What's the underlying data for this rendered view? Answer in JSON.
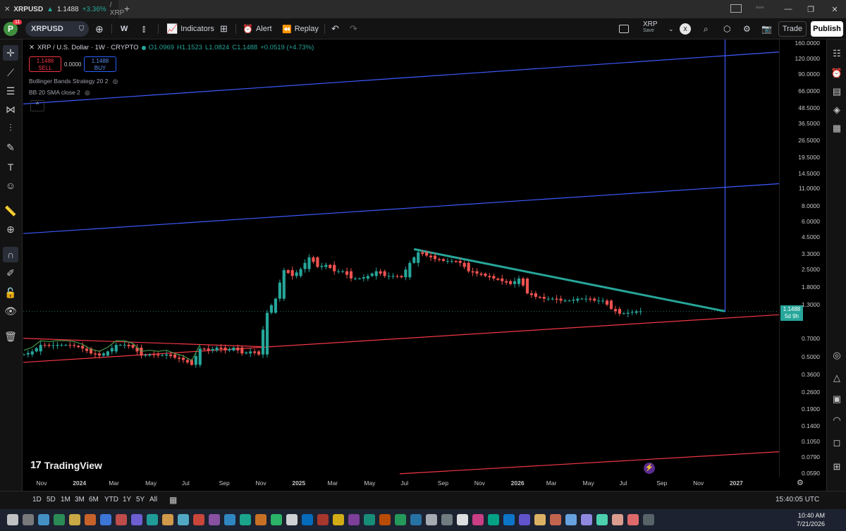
{
  "browser": {
    "tab_symbol": "XRPUSD",
    "tab_price": "1.1488",
    "tab_change": "+3.36%",
    "tab_suffix": "/ XRP",
    "new_tab": "+",
    "window_controls": [
      "minimize",
      "maximize",
      "close"
    ]
  },
  "toolbar": {
    "avatar_letter": "P",
    "avatar_badge": "11",
    "symbol": "XRPUSD",
    "interval": "W",
    "indicators": "Indicators",
    "alert": "Alert",
    "replay": "Replay",
    "layout_name": "XRP",
    "layout_sub": "Save",
    "x_badge": "X",
    "trade": "Trade",
    "publish": "Publish"
  },
  "legend": {
    "title": "XRP / U.S. Dollar · 1W · CRYPTO",
    "open": "O1.0969",
    "high": "H1.1523",
    "low": "L1.0824",
    "close": "C1.1488",
    "change": "+0.0519 (+4.73%)",
    "sell_price": "1.1488",
    "sell_label": "SELL",
    "spread": "0.0000",
    "buy_price": "1.1488",
    "buy_label": "BUY",
    "indicator1": "Bollinger Bands Strategy 20 2",
    "indicator2": "BB 20 SMA close 2",
    "collapse": "^"
  },
  "price_axis": {
    "labels": [
      "160.0000",
      "120.0000",
      "90.0000",
      "66.0000",
      "48.5000",
      "36.5000",
      "26.5000",
      "19.5000",
      "14.5000",
      "11.0000",
      "8.0000",
      "6.0000",
      "4.5000",
      "3.3000",
      "2.5000",
      "1.8000",
      "1.3000",
      "0.7000",
      "0.5000",
      "0.3600",
      "0.2600",
      "0.1900",
      "0.1400",
      "0.1050",
      "0.0790",
      "0.0590"
    ],
    "current_price": "1.1488",
    "countdown": "5d 9h"
  },
  "time_axis": {
    "labels": [
      "Nov",
      "2024",
      "Mar",
      "May",
      "Jul",
      "Sep",
      "Nov",
      "2025",
      "Mar",
      "May",
      "Jul",
      "Sep",
      "Nov",
      "2026",
      "Mar",
      "May",
      "Jul",
      "Sep",
      "Nov",
      "2027"
    ]
  },
  "bottom": {
    "ranges": [
      "1D",
      "5D",
      "1M",
      "3M",
      "6M",
      "YTD",
      "1Y",
      "5Y",
      "All"
    ],
    "clock": "15:40:05 UTC"
  },
  "watermark": "TradingView",
  "taskbar": {
    "time": "10:40 AM",
    "date": "7/21/2026"
  },
  "colors": {
    "up": "#26a69a",
    "down": "#ef5350",
    "blue_line": "#3d5afe",
    "red_line": "#f23645",
    "trend": "#26a69a",
    "publish_bg": "#ffffff"
  },
  "chart_data": {
    "type": "candlestick",
    "symbol": "XRP / U.S. Dollar",
    "interval": "1W",
    "yscale": "log",
    "ylim": [
      0.055,
      170
    ],
    "x_range": [
      "2023-10-01",
      "2027-03-15"
    ],
    "x_ticks": [
      "Nov",
      "2024",
      "Mar",
      "May",
      "Jul",
      "Sep",
      "Nov",
      "2025",
      "Mar",
      "May",
      "Jul",
      "Sep",
      "Nov",
      "2026",
      "Mar",
      "May",
      "Jul",
      "Sep",
      "Nov",
      "2027"
    ],
    "last_price": 1.1488,
    "weekly_closes": [
      {
        "date": "2023-10-02",
        "close": 0.52
      },
      {
        "date": "2023-10-16",
        "close": 0.55
      },
      {
        "date": "2023-10-30",
        "close": 0.62
      },
      {
        "date": "2023-11-13",
        "close": 0.61
      },
      {
        "date": "2023-11-27",
        "close": 0.62
      },
      {
        "date": "2023-12-11",
        "close": 0.62
      },
      {
        "date": "2023-12-25",
        "close": 0.61
      },
      {
        "date": "2024-01-08",
        "close": 0.58
      },
      {
        "date": "2024-01-22",
        "close": 0.53
      },
      {
        "date": "2024-02-05",
        "close": 0.51
      },
      {
        "date": "2024-02-19",
        "close": 0.55
      },
      {
        "date": "2024-03-04",
        "close": 0.62
      },
      {
        "date": "2024-03-18",
        "close": 0.62
      },
      {
        "date": "2024-04-01",
        "close": 0.59
      },
      {
        "date": "2024-04-15",
        "close": 0.51
      },
      {
        "date": "2024-04-29",
        "close": 0.52
      },
      {
        "date": "2024-05-13",
        "close": 0.51
      },
      {
        "date": "2024-05-27",
        "close": 0.52
      },
      {
        "date": "2024-06-10",
        "close": 0.49
      },
      {
        "date": "2024-06-24",
        "close": 0.47
      },
      {
        "date": "2024-07-08",
        "close": 0.43
      },
      {
        "date": "2024-07-22",
        "close": 0.58
      },
      {
        "date": "2024-08-05",
        "close": 0.56
      },
      {
        "date": "2024-08-19",
        "close": 0.59
      },
      {
        "date": "2024-09-02",
        "close": 0.56
      },
      {
        "date": "2024-09-16",
        "close": 0.59
      },
      {
        "date": "2024-09-30",
        "close": 0.53
      },
      {
        "date": "2024-10-14",
        "close": 0.55
      },
      {
        "date": "2024-10-28",
        "close": 0.52
      },
      {
        "date": "2024-11-11",
        "close": 1.12
      },
      {
        "date": "2024-11-25",
        "close": 1.45
      },
      {
        "date": "2024-12-09",
        "close": 2.45
      },
      {
        "date": "2024-12-23",
        "close": 2.2
      },
      {
        "date": "2025-01-06",
        "close": 2.5
      },
      {
        "date": "2025-01-20",
        "close": 3.1
      },
      {
        "date": "2025-02-03",
        "close": 2.6
      },
      {
        "date": "2025-02-17",
        "close": 2.7
      },
      {
        "date": "2025-03-03",
        "close": 2.4
      },
      {
        "date": "2025-03-17",
        "close": 2.4
      },
      {
        "date": "2025-03-31",
        "close": 2.1
      },
      {
        "date": "2025-04-14",
        "close": 2.1
      },
      {
        "date": "2025-04-28",
        "close": 2.2
      },
      {
        "date": "2025-05-12",
        "close": 2.4
      },
      {
        "date": "2025-05-26",
        "close": 2.2
      },
      {
        "date": "2025-06-09",
        "close": 2.2
      },
      {
        "date": "2025-06-23",
        "close": 2.15
      },
      {
        "date": "2025-07-07",
        "close": 2.8
      },
      {
        "date": "2025-07-21",
        "close": 3.4
      },
      {
        "date": "2025-08-04",
        "close": 3.2
      },
      {
        "date": "2025-08-18",
        "close": 3.0
      },
      {
        "date": "2025-09-01",
        "close": 2.9
      },
      {
        "date": "2025-09-15",
        "close": 2.9
      },
      {
        "date": "2025-09-29",
        "close": 2.8
      },
      {
        "date": "2025-10-13",
        "close": 2.4
      },
      {
        "date": "2025-10-27",
        "close": 2.3
      },
      {
        "date": "2025-11-10",
        "close": 2.2
      },
      {
        "date": "2025-11-24",
        "close": 2.1
      },
      {
        "date": "2025-12-08",
        "close": 2.0
      },
      {
        "date": "2025-12-22",
        "close": 1.9
      },
      {
        "date": "2026-01-05",
        "close": 2.1
      },
      {
        "date": "2026-01-19",
        "close": 1.6
      },
      {
        "date": "2026-02-02",
        "close": 1.5
      },
      {
        "date": "2026-02-16",
        "close": 1.45
      },
      {
        "date": "2026-03-02",
        "close": 1.45
      },
      {
        "date": "2026-03-16",
        "close": 1.4
      },
      {
        "date": "2026-03-30",
        "close": 1.4
      },
      {
        "date": "2026-04-13",
        "close": 1.45
      },
      {
        "date": "2026-04-27",
        "close": 1.45
      },
      {
        "date": "2026-05-11",
        "close": 1.4
      },
      {
        "date": "2026-05-25",
        "close": 1.4
      },
      {
        "date": "2026-06-08",
        "close": 1.2
      },
      {
        "date": "2026-06-22",
        "close": 1.1
      },
      {
        "date": "2026-07-06",
        "close": 1.12
      },
      {
        "date": "2026-07-20",
        "close": 1.1488
      }
    ],
    "drawings": [
      {
        "kind": "trendline",
        "color": "blue",
        "from": {
          "date": "2023-10-01",
          "price": 52
        },
        "to": {
          "date": "2027-03-15",
          "price": 135
        }
      },
      {
        "kind": "trendline",
        "color": "blue",
        "from": {
          "date": "2023-10-01",
          "price": 4.8
        },
        "to": {
          "date": "2027-03-15",
          "price": 12
        }
      },
      {
        "kind": "trendline",
        "color": "red",
        "from": {
          "date": "2023-10-01",
          "price": 0.45
        },
        "to": {
          "date": "2027-03-15",
          "price": 1.08
        }
      },
      {
        "kind": "trendline",
        "color": "red",
        "from": {
          "date": "2023-10-01",
          "price": 0.7
        },
        "to": {
          "date": "2024-11-01",
          "price": 0.6
        }
      },
      {
        "kind": "trendline",
        "color": "red",
        "from": {
          "date": "2025-06-20",
          "price": 0.058
        },
        "to": {
          "date": "2027-03-15",
          "price": 0.087
        }
      },
      {
        "kind": "trendline",
        "color": "teal",
        "from": {
          "date": "2025-07-14",
          "price": 3.6
        },
        "to": {
          "date": "2026-12-15",
          "price": 1.15
        }
      },
      {
        "kind": "vertical",
        "color": "blue",
        "date": "2026-12-15",
        "from_price": 1.15,
        "to_price": 170
      }
    ]
  }
}
